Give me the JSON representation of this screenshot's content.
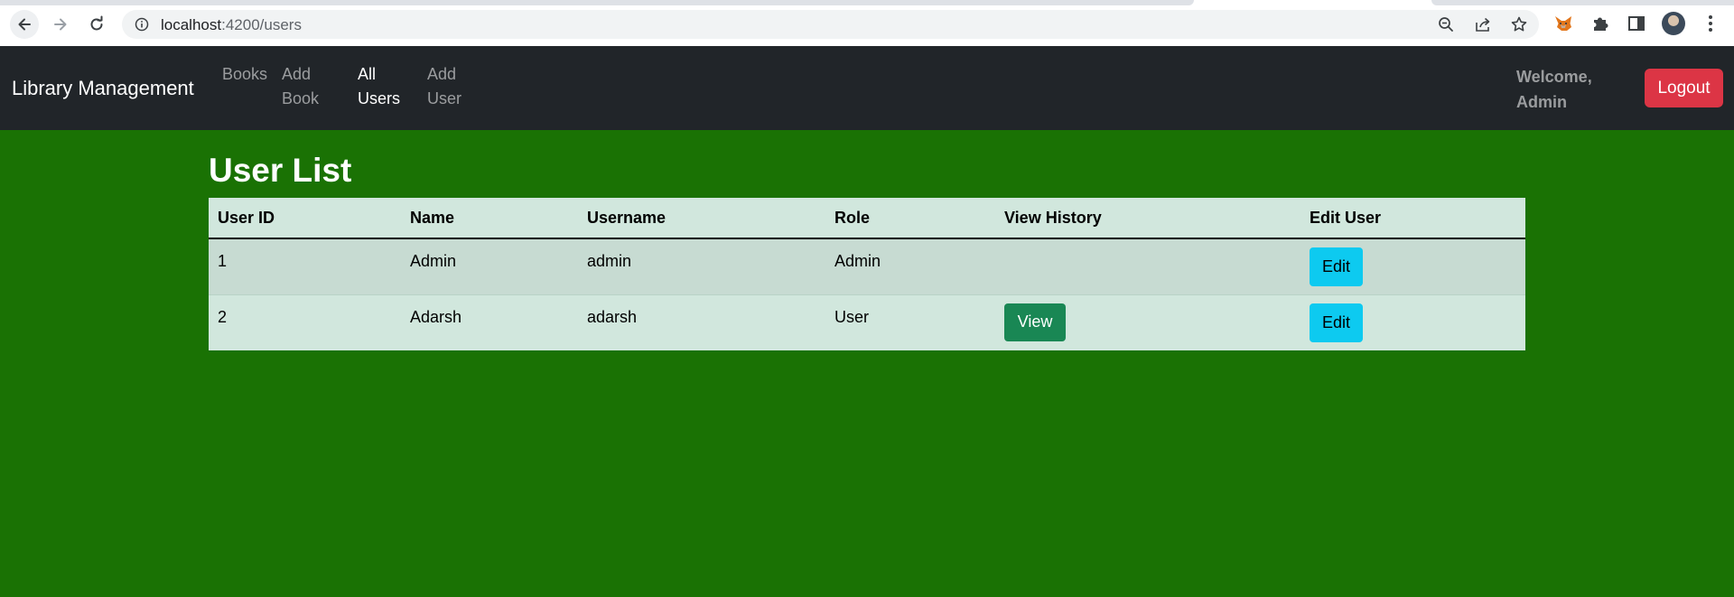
{
  "browser": {
    "url_host": "localhost",
    "url_path": ":4200/users"
  },
  "navbar": {
    "brand": "Library Management",
    "links": [
      {
        "line1": "Books",
        "line2": ""
      },
      {
        "line1": "Add",
        "line2": "Book"
      },
      {
        "line1": "All",
        "line2": "Users"
      },
      {
        "line1": "Add",
        "line2": "User"
      }
    ],
    "active_link": "All Users",
    "welcome_line1": "Welcome,",
    "welcome_line2": "Admin",
    "logout_label": "Logout"
  },
  "main": {
    "title": "User List",
    "table": {
      "headers": [
        "User ID",
        "Name",
        "Username",
        "Role",
        "View History",
        "Edit User"
      ],
      "rows": [
        {
          "id": "1",
          "name": "Admin",
          "username": "admin",
          "role": "Admin",
          "view_label": "",
          "edit_label": "Edit"
        },
        {
          "id": "2",
          "name": "Adarsh",
          "username": "adarsh",
          "role": "User",
          "view_label": "View",
          "edit_label": "Edit"
        }
      ]
    }
  },
  "colors": {
    "page_background": "#1a7204",
    "navbar": "#212529",
    "logout": "#dc3545",
    "edit_button": "#0dcaf0",
    "view_button": "#198754",
    "table_row": "#d1e7dd"
  },
  "icons": [
    "back-arrow-icon",
    "forward-arrow-icon",
    "reload-icon",
    "info-icon",
    "zoom-out-icon",
    "share-icon",
    "star-icon",
    "fox-extension-icon",
    "puzzle-icon",
    "side-panel-icon",
    "kebab-menu-icon"
  ]
}
